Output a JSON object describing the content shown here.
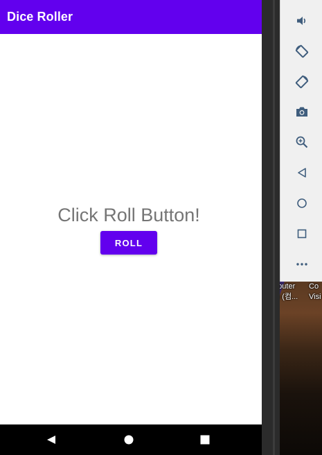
{
  "app": {
    "title": "Dice Roller",
    "prompt_text": "Click Roll Button!",
    "roll_button_label": "ROLL"
  },
  "colors": {
    "primary": "#6200ee",
    "prompt_text": "#757575",
    "nav_bar": "#000000",
    "toolbar_bg": "#f0f0f0",
    "toolbar_icon": "#3f5d7d"
  },
  "navigation": {
    "items": [
      {
        "name": "back",
        "icon": "triangle-back-icon"
      },
      {
        "name": "home",
        "icon": "circle-home-icon"
      },
      {
        "name": "recents",
        "icon": "square-recents-icon"
      }
    ]
  },
  "emulator_toolbar": {
    "items": [
      {
        "name": "volume",
        "icon": "volume-icon"
      },
      {
        "name": "rotate-left",
        "icon": "rotate-left-icon"
      },
      {
        "name": "rotate-right",
        "icon": "rotate-right-icon"
      },
      {
        "name": "screenshot",
        "icon": "camera-icon"
      },
      {
        "name": "zoom",
        "icon": "zoom-in-icon"
      },
      {
        "name": "back",
        "icon": "back-icon"
      },
      {
        "name": "home",
        "icon": "home-icon"
      },
      {
        "name": "overview",
        "icon": "overview-icon"
      },
      {
        "name": "more",
        "icon": "more-icon"
      }
    ]
  },
  "desktop": {
    "icon_labels": [
      {
        "line1": "mputer",
        "line2": "on (컴..."
      },
      {
        "line1": "Co",
        "line2": "Visi"
      }
    ]
  }
}
